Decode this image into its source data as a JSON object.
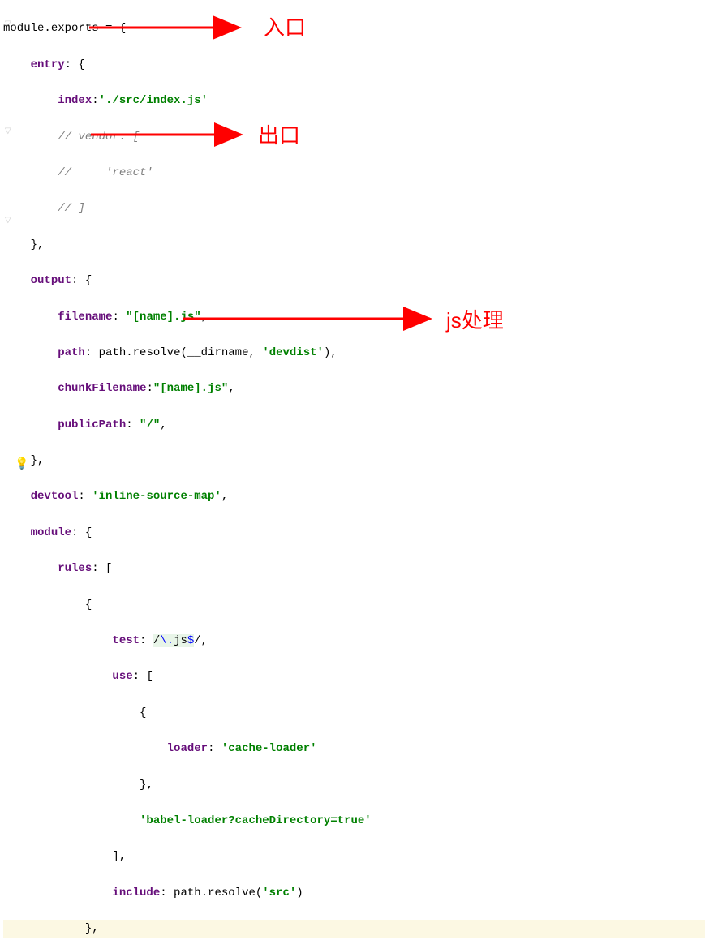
{
  "code": {
    "l1": {
      "a": "module",
      "b": "exports"
    },
    "l2": {
      "k": "entry"
    },
    "l3": {
      "k": "index",
      "v": "'./src/index.js'"
    },
    "l4": "// vendor: [",
    "l5": "//     'react'",
    "l6": "// ]",
    "l7": "},",
    "l8": {
      "k": "output"
    },
    "l9": {
      "k": "filename",
      "v": "\"[name].js\""
    },
    "l10": {
      "k": "path",
      "a": "path",
      "b": "resolve",
      "c": "__dirname",
      "d": "'devdist'"
    },
    "l11": {
      "k": "chunkFilename",
      "v": "\"[name].js\""
    },
    "l12": {
      "k": "publicPath",
      "v": "\"/\""
    },
    "l13": "},",
    "l14": {
      "k": "devtool",
      "v": "'inline-source-map'"
    },
    "l15": {
      "k": "module"
    },
    "l16": {
      "k": "rules"
    },
    "l17": "{",
    "l18": {
      "k": "test",
      "p": "/",
      "e": "\\.",
      "r": "js",
      "d": "$",
      "s": "/,"
    },
    "l19": {
      "k": "use"
    },
    "l20": "{",
    "l21": {
      "k": "loader",
      "v": "'cache-loader'"
    },
    "l22": "},",
    "l23": "'babel-loader?cacheDirectory=true'",
    "l24": "],",
    "l25": {
      "k": "include",
      "a": "path",
      "b": "resolve",
      "v": "'src'"
    },
    "l26": "},"
  },
  "annotations": {
    "a1": "入口",
    "a2": "出口",
    "a3": "js处理"
  }
}
